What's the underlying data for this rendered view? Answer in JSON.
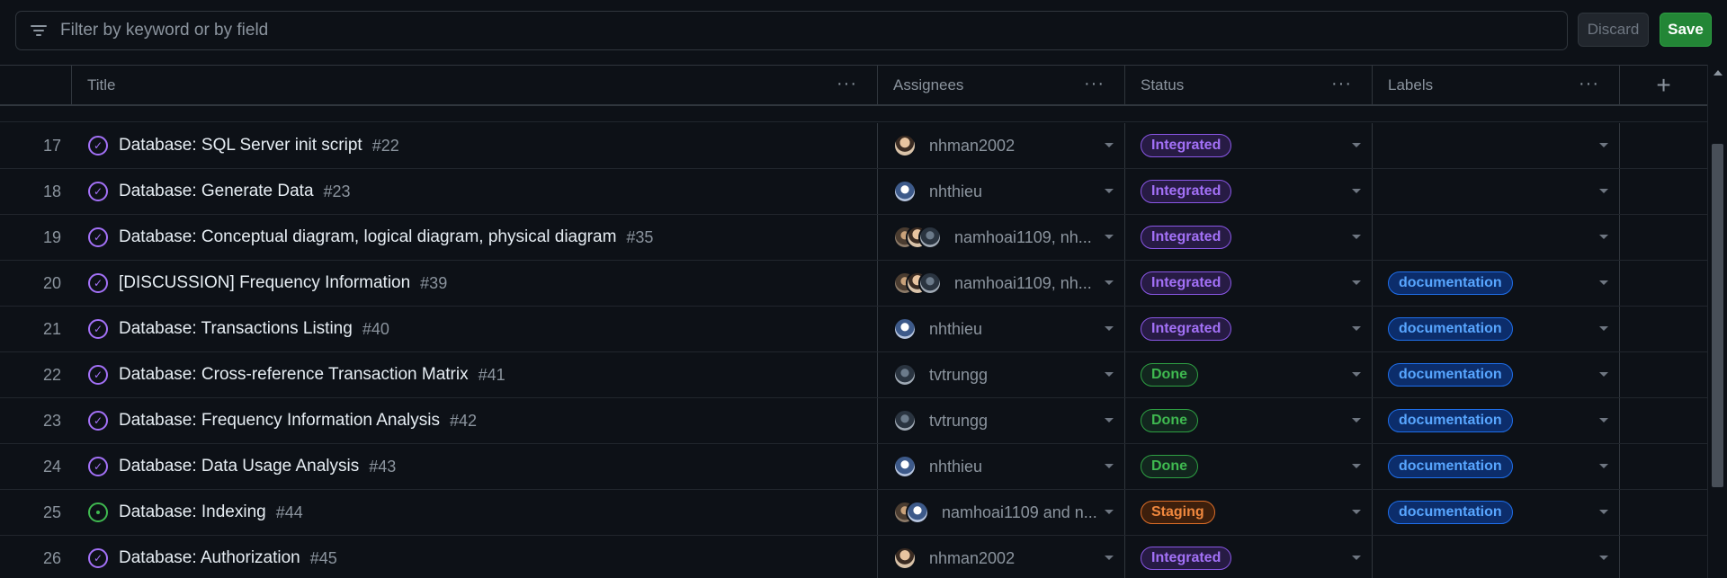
{
  "filter": {
    "placeholder": "Filter by keyword or by field",
    "value": ""
  },
  "buttons": {
    "discard": "Discard",
    "save": "Save"
  },
  "columns": [
    {
      "label": "Title"
    },
    {
      "label": "Assignees"
    },
    {
      "label": "Status"
    },
    {
      "label": "Labels"
    }
  ],
  "column_menu_glyph": "···",
  "add_column_glyph": "+",
  "status_colors": {
    "Integrated": {
      "fg": "#a371f7",
      "bg": "#271b44",
      "border": "#8957e5"
    },
    "Done": {
      "fg": "#3fb950",
      "bg": "#12261e",
      "border": "#2ea043"
    },
    "Staging": {
      "fg": "#f0883e",
      "bg": "#3d1f0c",
      "border": "#db6d28"
    }
  },
  "label_colors": {
    "documentation": {
      "fg": "#58a6ff",
      "bg": "#0c2d6b",
      "border": "#1f6feb"
    }
  },
  "rows": [
    {
      "num": "17",
      "state": "closed",
      "title": "Database: SQL Server init script",
      "issue": "#22",
      "avatars": [
        "a-nhman"
      ],
      "assignees": "nhman2002",
      "status": "Integrated",
      "labels": []
    },
    {
      "num": "18",
      "state": "closed",
      "title": "Database: Generate Data",
      "issue": "#23",
      "avatars": [
        "a-nhthieu"
      ],
      "assignees": "nhthieu",
      "status": "Integrated",
      "labels": []
    },
    {
      "num": "19",
      "state": "closed",
      "title": "Database: Conceptual diagram, logical diagram, physical diagram",
      "issue": "#35",
      "avatars": [
        "a-namhoai",
        "a-nhman",
        "a-tvtrung"
      ],
      "assignees": "namhoai1109, nh...",
      "status": "Integrated",
      "labels": []
    },
    {
      "num": "20",
      "state": "closed",
      "title": "[DISCUSSION] Frequency Information",
      "issue": "#39",
      "avatars": [
        "a-namhoai",
        "a-nhman",
        "a-tvtrung"
      ],
      "assignees": "namhoai1109, nh...",
      "status": "Integrated",
      "labels": [
        "documentation"
      ]
    },
    {
      "num": "21",
      "state": "closed",
      "title": "Database: Transactions Listing",
      "issue": "#40",
      "avatars": [
        "a-nhthieu"
      ],
      "assignees": "nhthieu",
      "status": "Integrated",
      "labels": [
        "documentation"
      ]
    },
    {
      "num": "22",
      "state": "closed",
      "title": "Database: Cross-reference Transaction Matrix",
      "issue": "#41",
      "avatars": [
        "a-tvtrung"
      ],
      "assignees": "tvtrungg",
      "status": "Done",
      "labels": [
        "documentation"
      ]
    },
    {
      "num": "23",
      "state": "closed",
      "title": "Database: Frequency Information Analysis",
      "issue": "#42",
      "avatars": [
        "a-tvtrung"
      ],
      "assignees": "tvtrungg",
      "status": "Done",
      "labels": [
        "documentation"
      ]
    },
    {
      "num": "24",
      "state": "closed",
      "title": "Database: Data Usage Analysis",
      "issue": "#43",
      "avatars": [
        "a-nhthieu"
      ],
      "assignees": "nhthieu",
      "status": "Done",
      "labels": [
        "documentation"
      ]
    },
    {
      "num": "25",
      "state": "open",
      "title": "Database: Indexing",
      "issue": "#44",
      "avatars": [
        "a-namhoai",
        "a-nhthieu"
      ],
      "assignees": "namhoai1109 and n...",
      "status": "Staging",
      "labels": [
        "documentation"
      ]
    },
    {
      "num": "26",
      "state": "closed",
      "title": "Database: Authorization",
      "issue": "#45",
      "avatars": [
        "a-nhman"
      ],
      "assignees": "nhman2002",
      "status": "Integrated",
      "labels": []
    }
  ]
}
